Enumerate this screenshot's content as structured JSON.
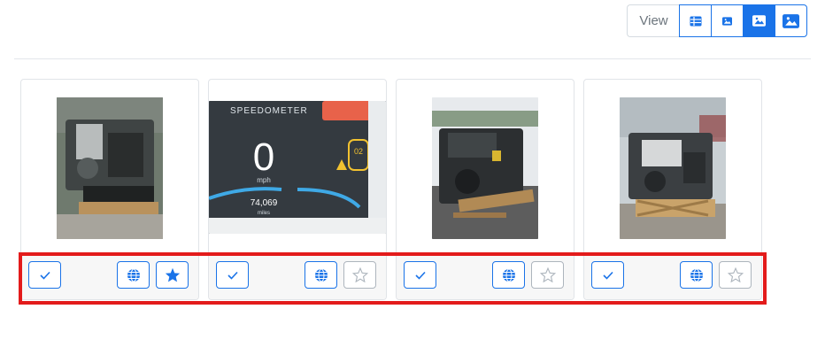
{
  "view": {
    "label": "View",
    "buttons": [
      {
        "name": "table-view",
        "icon": "table-icon",
        "active": false
      },
      {
        "name": "small-image-view",
        "icon": "small-image-icon",
        "active": false
      },
      {
        "name": "medium-image-view",
        "icon": "image-icon",
        "active": true
      },
      {
        "name": "large-image-view",
        "icon": "large-image-icon",
        "active": false
      }
    ]
  },
  "colors": {
    "accent": "#1a73e8",
    "highlight": "#e31b1b",
    "inactive_star": "#adb5bd"
  },
  "cards": [
    {
      "image": "engine-photo",
      "starred": true
    },
    {
      "image": "speedometer-photo",
      "starred": false,
      "speedometer": {
        "title": "SPEEDOMETER",
        "speed": "0",
        "unit": "mph",
        "odometer": "74,069",
        "odometer_unit": "miles",
        "gear": "02"
      }
    },
    {
      "image": "engine-photo",
      "starred": false
    },
    {
      "image": "engine-photo",
      "starred": false
    }
  ]
}
